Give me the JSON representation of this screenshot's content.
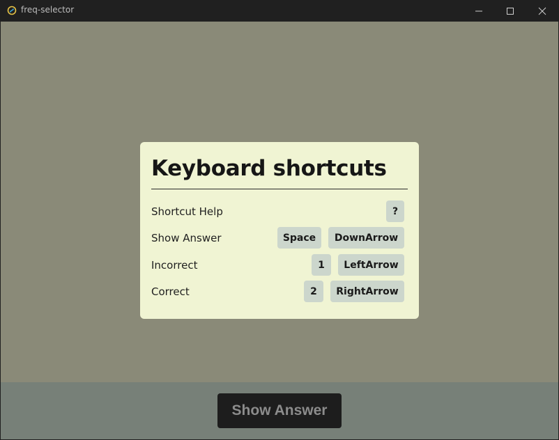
{
  "window": {
    "title": "freq-selector",
    "icons": {
      "app": "app-icon",
      "minimize": "minimize-icon",
      "maximize": "maximize-icon",
      "close": "close-icon"
    }
  },
  "modal": {
    "title": "Keyboard shortcuts",
    "rows": [
      {
        "label": "Shortcut Help",
        "keys": [
          "?"
        ]
      },
      {
        "label": "Show Answer",
        "keys": [
          "Space",
          "DownArrow"
        ]
      },
      {
        "label": "Incorrect",
        "keys": [
          "1",
          "LeftArrow"
        ]
      },
      {
        "label": "Correct",
        "keys": [
          "2",
          "RightArrow"
        ]
      }
    ]
  },
  "footer": {
    "show_answer_label": "Show Answer"
  },
  "colors": {
    "background": "#8a8a78",
    "bottom_bar": "#778078",
    "modal_bg": "#f0f4d3",
    "kbd_bg": "#ccd6cc",
    "button_bg": "#1d1d1d",
    "button_text": "#8c8c8c"
  }
}
